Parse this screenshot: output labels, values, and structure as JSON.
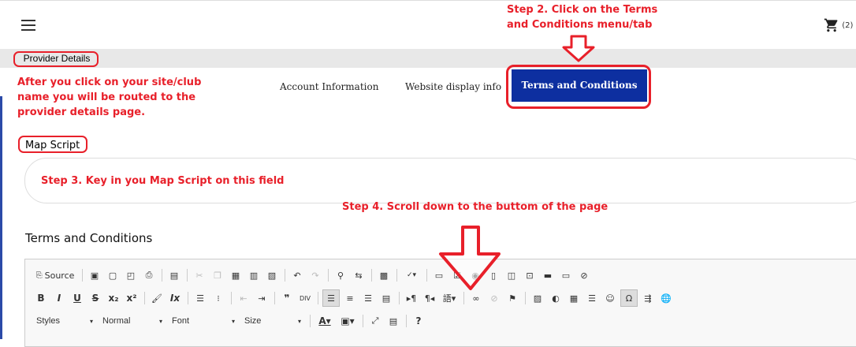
{
  "header": {
    "cart_count": "(2)"
  },
  "section": {
    "title": "Provider Details"
  },
  "tabs": [
    {
      "label": "Account Information"
    },
    {
      "label": "Website display info"
    },
    {
      "label": "Terms and Conditions"
    }
  ],
  "form": {
    "map_script_label": "Map Script",
    "map_script_value": "",
    "terms_heading": "Terms and Conditions"
  },
  "editor": {
    "source_label": "Source",
    "styles_label": "Styles",
    "format_label": "Normal",
    "font_label": "Font",
    "size_label": "Size"
  },
  "annotations": {
    "step2": [
      "Step 2. Click on the Terms",
      "and Conditions menu/tab"
    ],
    "step1": [
      "After you click on your site/club",
      "name you will be routed to the",
      "provider details page."
    ],
    "step3": "Step 3. Key in you Map Script on this field",
    "step4": "Step 4. Scroll down to the buttom of the page"
  },
  "colors": {
    "annotation": "#e8202a",
    "active_tab": "#0d2fa0",
    "gray_bar": "#e8e8e8"
  }
}
